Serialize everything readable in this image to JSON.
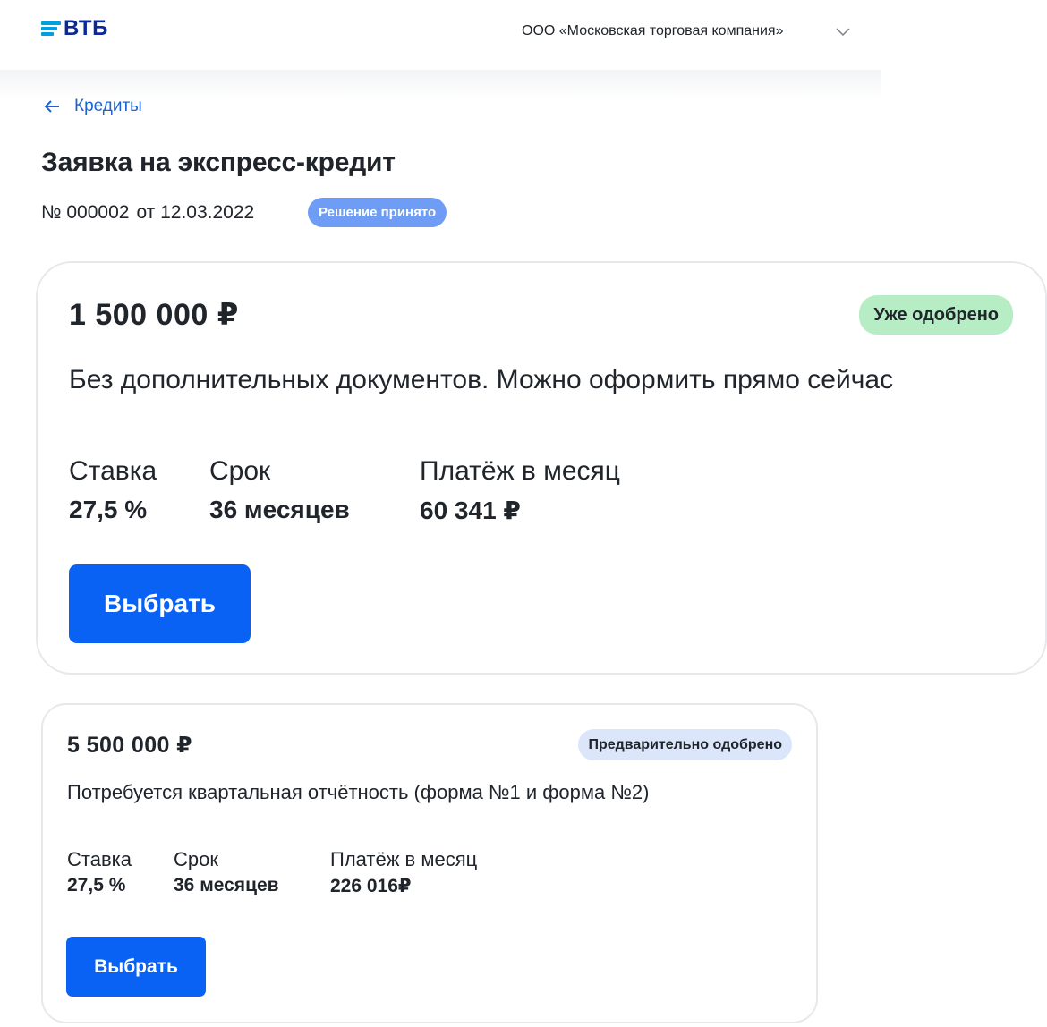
{
  "header": {
    "logo_text": "ВТБ",
    "company_name": "ООО «Московская торговая компания»",
    "logo_color": "#0a2896",
    "logo_bars_color": "#009fdf"
  },
  "breadcrumb": {
    "back_label": "Кредиты"
  },
  "application": {
    "title": "Заявка на экспресс-кредит",
    "number": "№ 000002",
    "date": "от 12.03.2022",
    "status": "Решение принято"
  },
  "offers": [
    {
      "amount": "1 500 000 ₽",
      "badge": "Уже одобрено",
      "badge_color": "#b7edc4",
      "description": "Без дополнительных документов. Можно оформить прямо сейчас",
      "rate_label": "Ставка",
      "rate_value": "27,5 %",
      "term_label": "Срок",
      "term_value": "36 месяцев",
      "payment_label": "Платёж в месяц",
      "payment_value": "60 341 ₽",
      "button_label": "Выбрать"
    },
    {
      "amount": "5 500 000 ₽",
      "badge": "Предварительно одобрено",
      "badge_color": "#dbe6fb",
      "description": "Потребуется квартальная отчётность (форма №1 и форма №2)",
      "rate_label": "Ставка",
      "rate_value": "27,5 %",
      "term_label": "Срок",
      "term_value": "36 месяцев",
      "payment_label": "Платёж в месяц",
      "payment_value": "226 016₽",
      "button_label": "Выбрать"
    }
  ],
  "colors": {
    "accent": "#0a62f5",
    "link": "#1c62d1",
    "status_pill": "#6f9df5",
    "text": "#20252c"
  },
  "icons": {
    "back": "arrow-left-icon",
    "dropdown": "chevron-down-icon"
  }
}
